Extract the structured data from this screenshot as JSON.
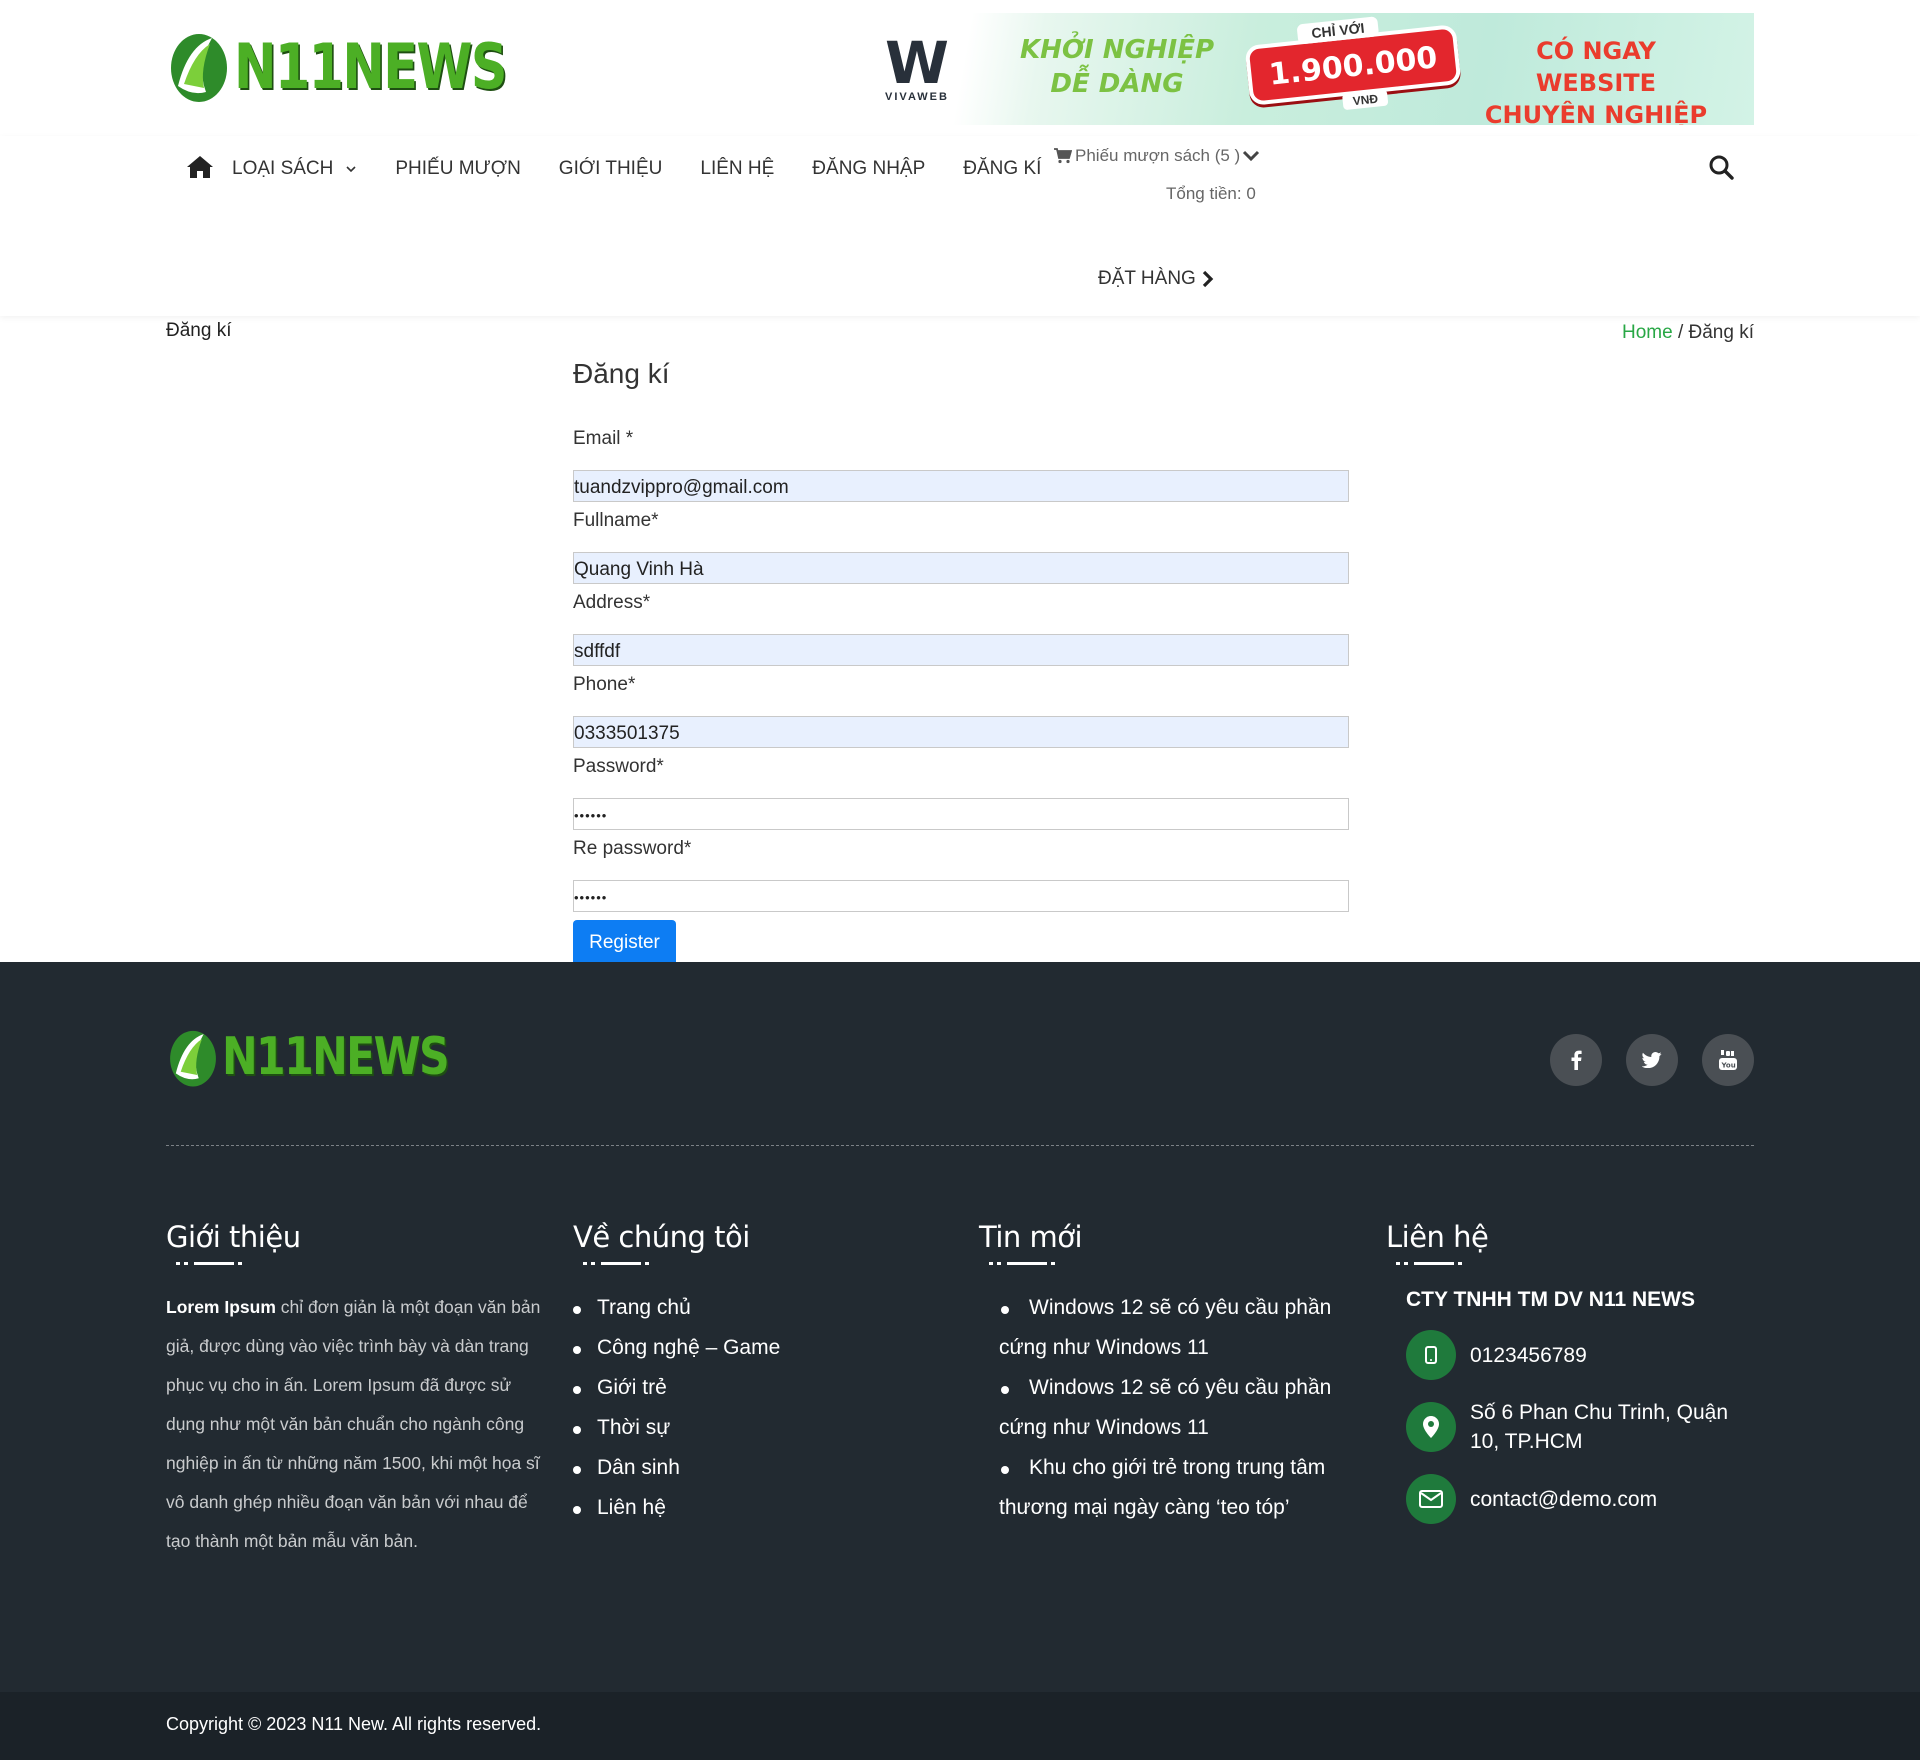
{
  "brand": {
    "logo_text": "N11NEWS",
    "accent": "#28a745",
    "footer_bg": "#222a31"
  },
  "banner": {
    "brand": "VIVAWEB",
    "headline_1": "KHỞI NGHIỆP",
    "headline_2": "DỄ DÀNG",
    "price_prefix": "CHỈ VỚI",
    "price": "1.900.000",
    "price_unit": "VNĐ",
    "cta_1": "CÓ NGAY WEBSITE",
    "cta_2": "CHUYÊN NGHIỆP"
  },
  "nav": {
    "items": [
      {
        "label": "LOẠI SÁCH",
        "has_dropdown": true
      },
      {
        "label": "PHIẾU MƯỢN"
      },
      {
        "label": "GIỚI THIỆU"
      },
      {
        "label": "LIÊN HỆ"
      },
      {
        "label": "ĐĂNG NHẬP"
      },
      {
        "label": "ĐĂNG KÍ"
      }
    ],
    "cart_label": "Phiếu mượn sách (5 )",
    "total_label": "Tổng tiền: 0",
    "order_label": "ĐẶT HÀNG"
  },
  "breadcrumb": {
    "page_title": "Đăng kí",
    "home": "Home",
    "separator": " / ",
    "current": "Đăng kí"
  },
  "form": {
    "title": "Đăng kí",
    "fields": [
      {
        "label": "Email *",
        "value": "tuandzvippro@gmail.com"
      },
      {
        "label": "Fullname*",
        "value": "Quang Vinh Hà"
      },
      {
        "label": "Address*",
        "value": "sdffdf"
      },
      {
        "label": "Phone*",
        "value": "0333501375"
      },
      {
        "label": "Password*",
        "value": "••••••"
      },
      {
        "label": "Re password*",
        "value": "••••••"
      }
    ],
    "submit_label": "Register"
  },
  "footer": {
    "logo_text": "N11NEWS",
    "socials": [
      "facebook-icon",
      "twitter-icon",
      "youtube-icon"
    ],
    "about": {
      "heading": "Giới thiệu",
      "bold": "Lorem Ipsum",
      "text": " chỉ đơn giản là một đoạn văn bản giả, được dùng vào việc trình bày và dàn trang phục vụ cho in ấn. Lorem Ipsum đã được sử dụng như một văn bản chuẩn cho ngành công nghiệp in ấn từ những năm 1500, khi một họa sĩ vô danh ghép nhiều đoạn văn bản với nhau để tạo thành một bản mẫu văn bản."
    },
    "about_us": {
      "heading": "Về chúng tôi",
      "links": [
        "Trang chủ",
        "Công nghệ – Game",
        "Giới trẻ",
        "Thời sự",
        "Dân sinh",
        "Liên hệ"
      ]
    },
    "news": {
      "heading": "Tin mới",
      "items": [
        "Windows 12 sẽ có yêu cầu phần cứng như Windows 11",
        "Windows 12 sẽ có yêu cầu phần cứng như Windows 11",
        "Khu cho giới trẻ trong trung tâm thương mại ngày càng ‘teo tóp’"
      ]
    },
    "contact": {
      "heading": "Liên hệ",
      "company": "CTY TNHH TM DV N11 NEWS",
      "phone": "0123456789",
      "address": "Số 6 Phan Chu Trinh, Quận 10, TP.HCM",
      "email": "contact@demo.com"
    },
    "copyright": "Copyright © 2023  N11 New. All rights reserved."
  }
}
